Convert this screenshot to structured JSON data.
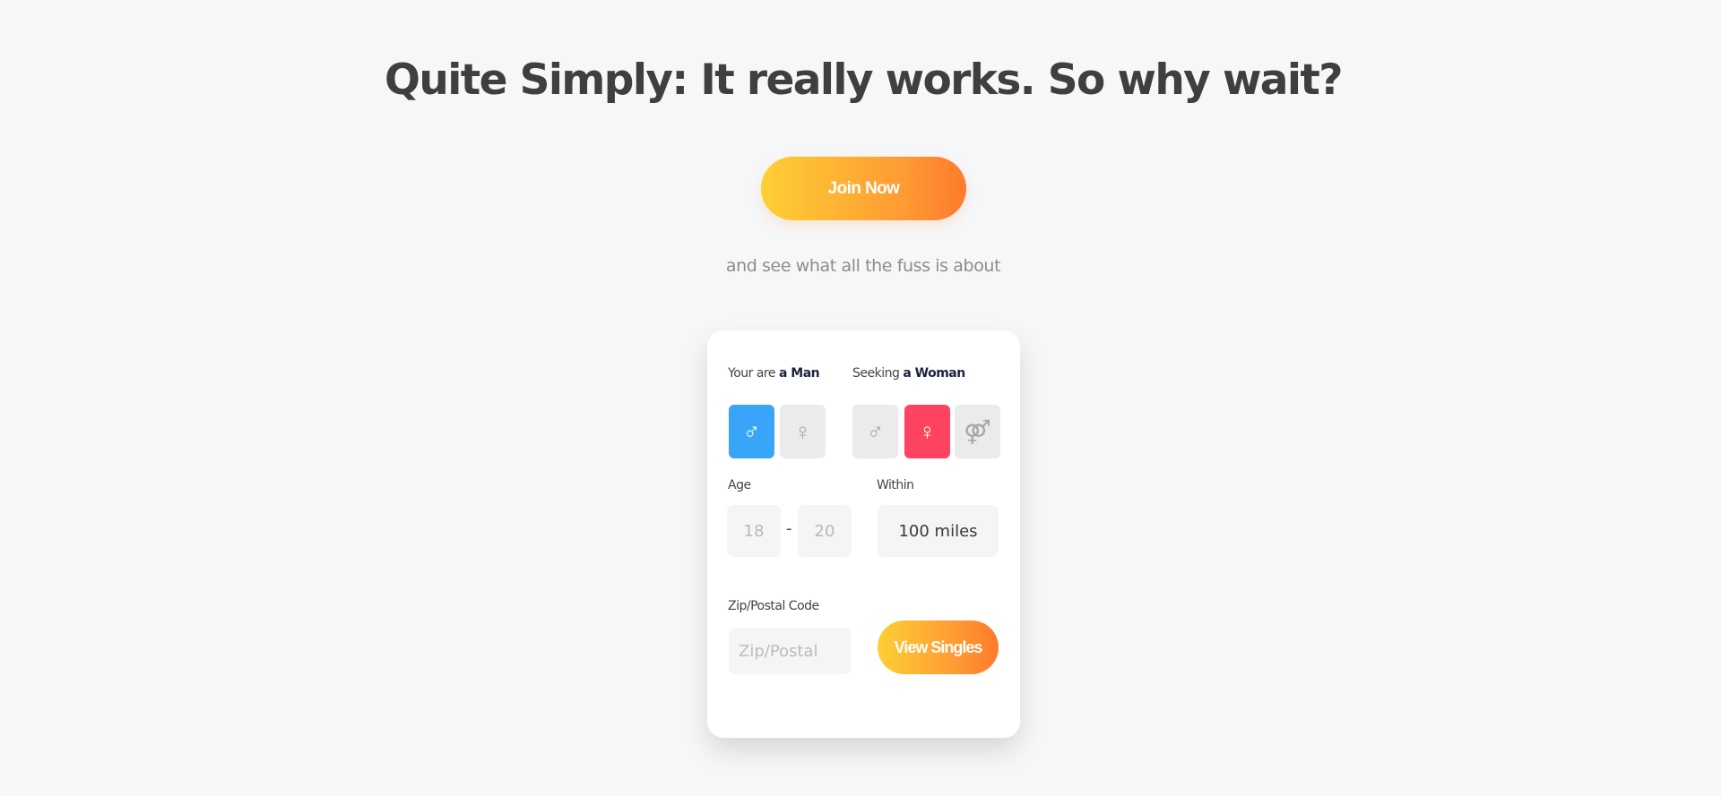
{
  "hero": {
    "headline": "Quite Simply: It really works. So why wait?",
    "join_label": "Join Now",
    "tagline": "and see what all the fuss is about"
  },
  "search": {
    "you_are": {
      "prefix": "Your are",
      "value": "a Man"
    },
    "seeking": {
      "prefix": "Seeking",
      "value": "a Woman"
    },
    "icons": {
      "male": "♂",
      "female": "♀",
      "both": "⚤"
    },
    "you_are_options": [
      {
        "name": "male",
        "selected": true
      },
      {
        "name": "female",
        "selected": false
      }
    ],
    "seeking_options": [
      {
        "name": "male",
        "selected": false
      },
      {
        "name": "female",
        "selected": true
      },
      {
        "name": "both",
        "selected": false
      }
    ],
    "age": {
      "label": "Age",
      "min": "18",
      "separator": "-",
      "max": "20"
    },
    "within": {
      "label": "Within",
      "value": "100 miles"
    },
    "zip": {
      "label": "Zip/Postal Code",
      "placeholder": "Zip/Postal",
      "value": ""
    },
    "submit_label": "View Singles"
  },
  "colors": {
    "male_selected": "#39a5f9",
    "female_selected": "#fe4360",
    "gradient_start": "#fecf34",
    "gradient_end": "#fe7a2c"
  }
}
